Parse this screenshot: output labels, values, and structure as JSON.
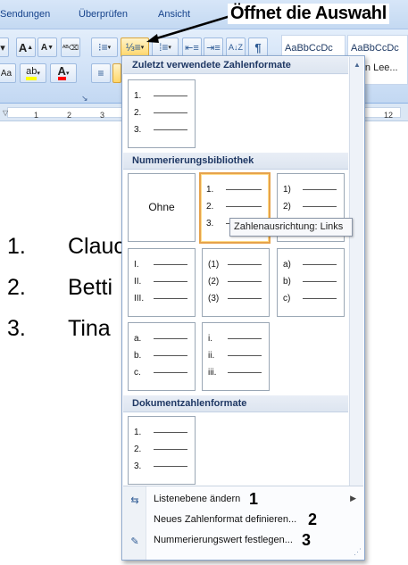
{
  "ribbon": {
    "tabs": [
      "Sendungen",
      "Überprüfen",
      "Ansicht"
    ],
    "font_grow": "A",
    "font_shrink": "A",
    "clear_format": "Aa",
    "highlight": "ab",
    "font_color": "A",
    "styles": [
      {
        "preview": "AaBbCcDc",
        "name": ""
      },
      {
        "preview": "AaBbCcDc",
        "name": "Kein Lee..."
      }
    ],
    "colors": {
      "ribbon_bg": "#d1e2f7",
      "tab_text": "#15428b",
      "highlight_yellow": "#ffff00",
      "font_red": "#ff0000"
    }
  },
  "ruler": {
    "numbers": [
      "1",
      "2",
      "3",
      "12"
    ]
  },
  "document": {
    "items": [
      {
        "num": "1.",
        "text": "Clauc"
      },
      {
        "num": "2.",
        "text": "Betti"
      },
      {
        "num": "3.",
        "text": "Tina"
      }
    ]
  },
  "annotation": {
    "text": "Öffnet die Auswahl"
  },
  "gallery": {
    "sections": {
      "recent": "Zuletzt verwendete Zahlenformate",
      "library": "Nummerierungsbibliothek",
      "document": "Dokumentzahlenformate"
    },
    "recent_formats": [
      {
        "markers": [
          "1.",
          "2.",
          "3."
        ]
      }
    ],
    "library_formats": [
      {
        "label": "Ohne",
        "markers": []
      },
      {
        "markers": [
          "1.",
          "2.",
          "3."
        ],
        "selected": true
      },
      {
        "markers": [
          "1)",
          "2)",
          "3)"
        ]
      },
      {
        "markers": [
          "I.",
          "II.",
          "III."
        ]
      },
      {
        "markers": [
          "(1)",
          "(2)",
          "(3)"
        ]
      },
      {
        "markers": [
          "a)",
          "b)",
          "c)"
        ]
      },
      {
        "markers": [
          "a.",
          "b.",
          "c."
        ]
      },
      {
        "markers": [
          "i.",
          "ii.",
          "iii."
        ]
      }
    ],
    "document_formats": [
      {
        "markers": [
          "1.",
          "2.",
          "3."
        ]
      }
    ],
    "tooltip": "Zahlenausrichtung: Links",
    "menu": [
      {
        "label": "Listenebene ändern",
        "step": "1",
        "submenu": true
      },
      {
        "label": "Neues Zahlenformat definieren...",
        "step": "2"
      },
      {
        "label": "Nummerierungswert festlegen...",
        "step": "3"
      }
    ],
    "colors": {
      "selected_border": "#e6a24c",
      "header_text": "#1f3864"
    }
  }
}
